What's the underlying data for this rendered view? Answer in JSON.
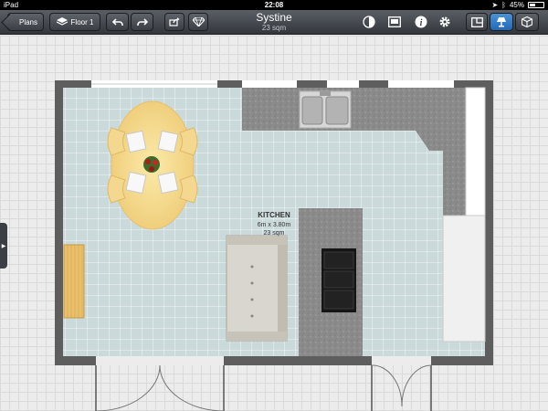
{
  "status_bar": {
    "carrier": "iPad",
    "time": "22:08",
    "battery": "45%",
    "battery_level": 0.45
  },
  "toolbar": {
    "plans_label": "Plans",
    "floor_label": "Floor 1",
    "title": "Systine",
    "subtitle": "23 sqm"
  },
  "room": {
    "name": "KITCHEN",
    "dimensions": "6m x 3.80m",
    "area": "23 sqm"
  },
  "colors": {
    "toolbar_active": "#2f7ccd",
    "floor_tile": "#c9d8d8",
    "wall": "#5f5f5f",
    "table_wood": "#f5d98f"
  }
}
